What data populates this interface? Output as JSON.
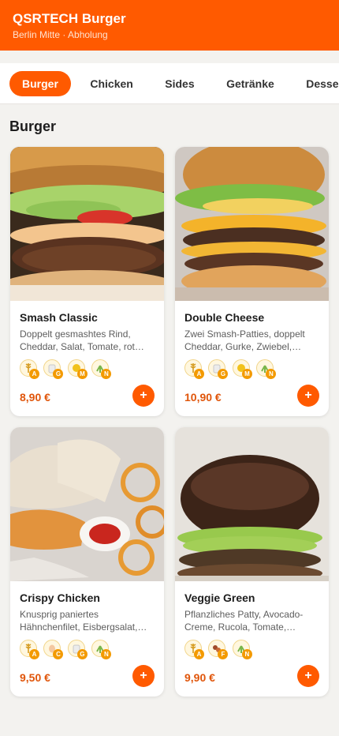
{
  "header": {
    "title": "QSRTECH Burger",
    "subtitle": "Berlin Mitte · Abholung"
  },
  "tabs": [
    {
      "label": "Burger",
      "active": true
    },
    {
      "label": "Chicken",
      "active": false
    },
    {
      "label": "Sides",
      "active": false
    },
    {
      "label": "Getränke",
      "active": false
    },
    {
      "label": "Desserts",
      "active": false
    }
  ],
  "section": {
    "title": "Burger"
  },
  "products": [
    {
      "name": "Smash Classic",
      "description": "Doppelt gesmashtes Rind, Cheddar, Salat, Tomate, rot…",
      "price": "8,90 €",
      "allergens": [
        {
          "letter": "A",
          "icon": "gluten-wheat-icon"
        },
        {
          "letter": "G",
          "icon": "milk-icon"
        },
        {
          "letter": "M",
          "icon": "mustard-icon"
        },
        {
          "letter": "N",
          "icon": "celery-icon"
        }
      ],
      "add_label": "+"
    },
    {
      "name": "Double Cheese",
      "description": "Zwei Smash-Patties, doppelt Cheddar, Gurke, Zwiebel,…",
      "price": "10,90 €",
      "allergens": [
        {
          "letter": "A",
          "icon": "gluten-wheat-icon"
        },
        {
          "letter": "G",
          "icon": "milk-icon"
        },
        {
          "letter": "M",
          "icon": "mustard-icon"
        },
        {
          "letter": "N",
          "icon": "celery-icon"
        }
      ],
      "add_label": "+"
    },
    {
      "name": "Crispy Chicken",
      "description": "Knusprig paniertes Hähnchenfilet, Eisbergsalat,…",
      "price": "9,50 €",
      "allergens": [
        {
          "letter": "A",
          "icon": "gluten-wheat-icon"
        },
        {
          "letter": "C",
          "icon": "egg-icon"
        },
        {
          "letter": "G",
          "icon": "milk-icon"
        },
        {
          "letter": "N",
          "icon": "celery-icon"
        }
      ],
      "add_label": "+"
    },
    {
      "name": "Veggie Green",
      "description": "Pflanzliches Patty, Avocado-Creme, Rucola, Tomate,…",
      "price": "9,90 €",
      "allergens": [
        {
          "letter": "A",
          "icon": "gluten-wheat-icon"
        },
        {
          "letter": "F",
          "icon": "soy-icon"
        },
        {
          "letter": "N",
          "icon": "celery-icon"
        }
      ],
      "add_label": "+"
    }
  ],
  "colors": {
    "brand": "#ff5a00",
    "price": "#e0550a",
    "badge": "#f39a00"
  }
}
